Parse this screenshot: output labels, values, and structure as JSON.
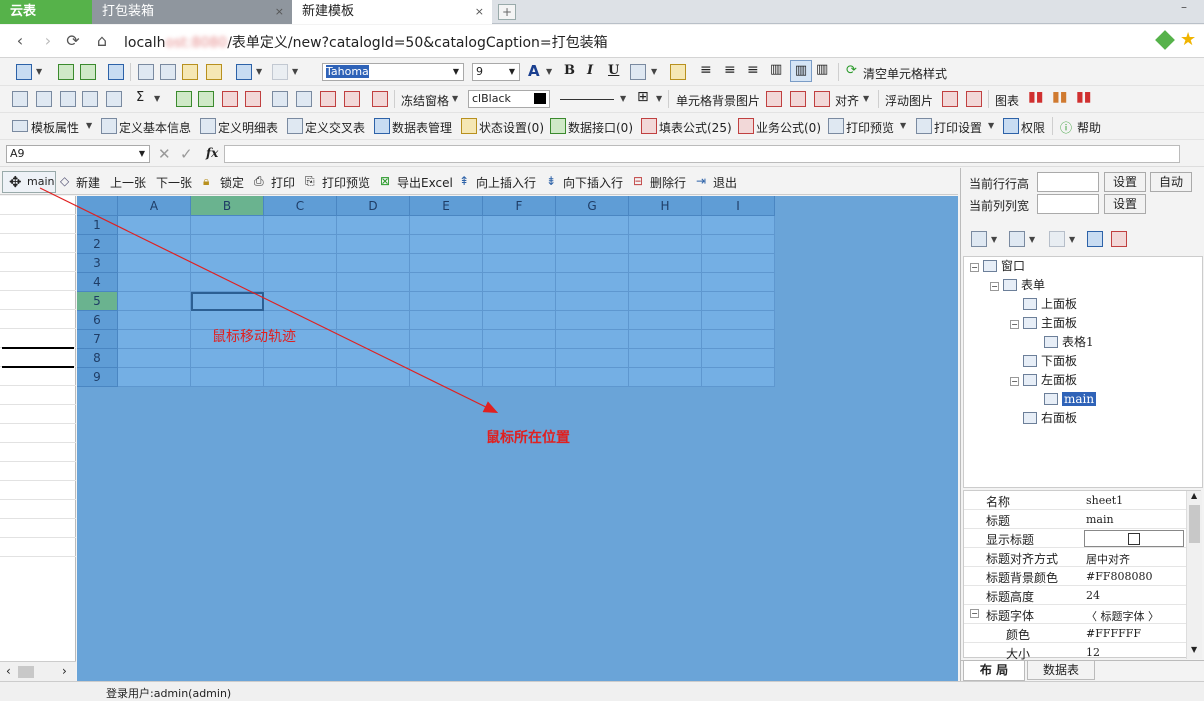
{
  "tabs": {
    "app": "云表",
    "pack": "打包装箱",
    "new_template": "新建模板",
    "close": "×",
    "new_tab": "+",
    "minimize": "–"
  },
  "address": {
    "url_prefix": "localh",
    "url_blurred": "ost:8080",
    "url_rest": "/表单定义/new?catalogId=50&catalogCaption=打包装箱"
  },
  "toolbar1": {
    "font_name": "Tahoma",
    "font_size": "9",
    "clear_style": "清空单元格样式"
  },
  "toolbar2": {
    "freeze": "冻结窗格",
    "color_name": "clBlack",
    "cell_bg_image": "单元格背景图片",
    "align": "对齐",
    "float_image": "浮动图片",
    "chart": "图表"
  },
  "toolbar3": {
    "items": [
      "模板属性",
      "定义基本信息",
      "定义明细表",
      "定义交叉表",
      "数据表管理",
      "状态设置(0)",
      "数据接口(0)",
      "填表公式(25)",
      "业务公式(0)",
      "打印预览",
      "打印设置",
      "权限",
      "帮助"
    ]
  },
  "formula": {
    "cell_ref": "A9",
    "fx": "fx"
  },
  "sheet_toolbar": {
    "main": "main",
    "items": [
      "新建",
      "上一张",
      "下一张",
      "锁定",
      "打印",
      "打印预览",
      "导出Excel",
      "向上插入行",
      "向下插入行",
      "删除行",
      "退出"
    ]
  },
  "grid": {
    "columns": [
      "A",
      "B",
      "C",
      "D",
      "E",
      "F",
      "G",
      "H",
      "I"
    ],
    "rows": [
      "1",
      "2",
      "3",
      "4",
      "5",
      "6",
      "7",
      "8",
      "9"
    ]
  },
  "annotations": {
    "trail": "鼠标移动轨迹",
    "position": "鼠标所在位置"
  },
  "right_panel": {
    "row_height_label": "当前行行高",
    "col_width_label": "当前列列宽",
    "set": "设置",
    "auto": "自动"
  },
  "tree": {
    "window": "窗口",
    "form": "表单",
    "top": "上面板",
    "main_panel": "主面板",
    "table1": "表格1",
    "bottom": "下面板",
    "left": "左面板",
    "main": "main",
    "right": "右面板"
  },
  "props": [
    {
      "name": "名称",
      "value": "sheet1"
    },
    {
      "name": "标题",
      "value": "main"
    },
    {
      "name": "显示标题",
      "value": ""
    },
    {
      "name": "标题对齐方式",
      "value": "居中对齐"
    },
    {
      "name": "标题背景颜色",
      "value": "#FF808080"
    },
    {
      "name": "标题高度",
      "value": "24"
    },
    {
      "name": "标题字体",
      "value": "〈 标题字体 〉"
    },
    {
      "name": "颜色",
      "value": "#FFFFFF"
    },
    {
      "name": "大小",
      "value": "12"
    }
  ],
  "right_tabs": {
    "layout": "布 局",
    "datatable": "数据表"
  },
  "status": {
    "user": "登录用户:admin(admin)"
  },
  "colors": {
    "canvas": "#6aa4d8",
    "arrow": "#e02020",
    "accent": "#56b24a"
  }
}
